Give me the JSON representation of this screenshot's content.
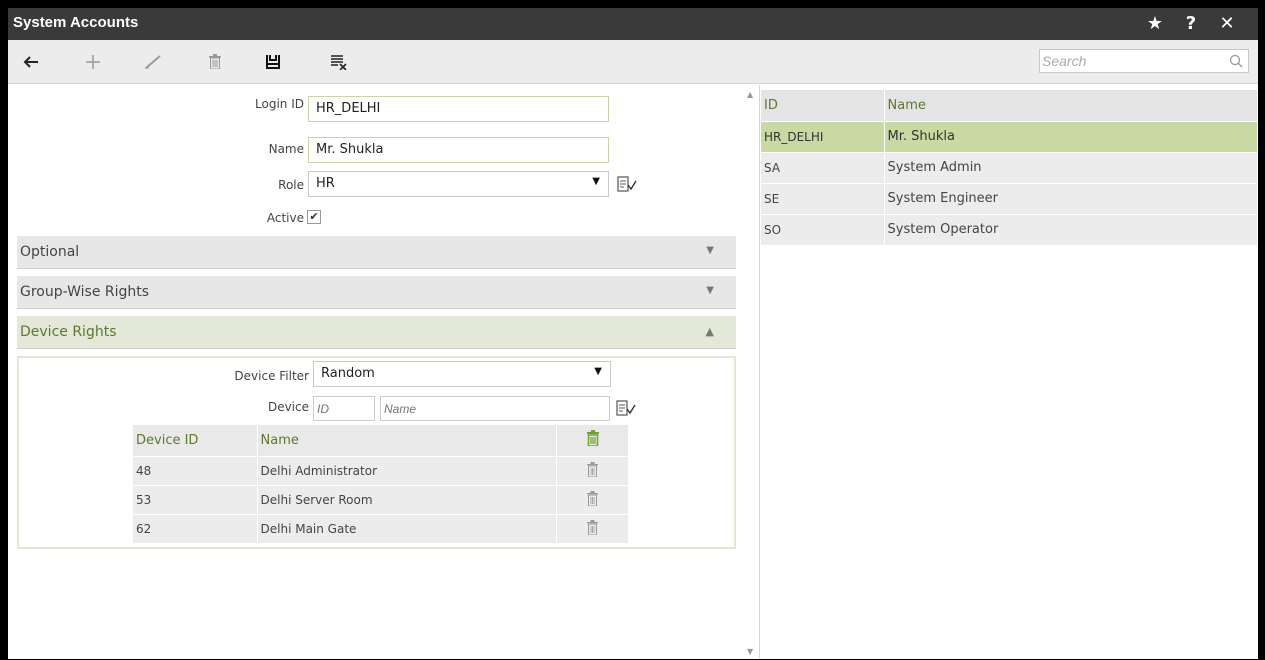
{
  "window": {
    "title": "System Accounts"
  },
  "titlebar": {
    "star": "★",
    "help": "?",
    "close": "✕"
  },
  "toolbar": {
    "search_placeholder": "Search"
  },
  "form": {
    "login_id_label": "Login ID",
    "login_id_value": "HR_DELHI",
    "name_label": "Name",
    "name_value": "Mr. Shukla",
    "role_label": "Role",
    "role_value": "HR",
    "active_label": "Active",
    "active_checked": true
  },
  "sections": {
    "optional": "Optional",
    "group_rights": "Group-Wise Rights",
    "device_rights": "Device Rights"
  },
  "device_rights": {
    "filter_label": "Device Filter",
    "filter_value": "Random",
    "device_label": "Device",
    "device_id_placeholder": "ID",
    "device_name_placeholder": "Name",
    "columns": [
      "Device ID",
      "Name"
    ],
    "rows": [
      {
        "id": "48",
        "name": "Delhi Administrator"
      },
      {
        "id": "53",
        "name": "Delhi Server Room"
      },
      {
        "id": "62",
        "name": "Delhi Main Gate"
      }
    ]
  },
  "accounts": {
    "columns": [
      "ID",
      "Name"
    ],
    "rows": [
      {
        "id": "HR_DELHI",
        "name": "Mr. Shukla",
        "selected": true
      },
      {
        "id": "SA",
        "name": "System Admin"
      },
      {
        "id": "SE",
        "name": "System Engineer"
      },
      {
        "id": "SO",
        "name": "System Operator"
      }
    ]
  },
  "colors": {
    "accent": "#5b7a2c",
    "selected_row": "#c8d9a2",
    "titlebar": "#3a3a3a"
  }
}
